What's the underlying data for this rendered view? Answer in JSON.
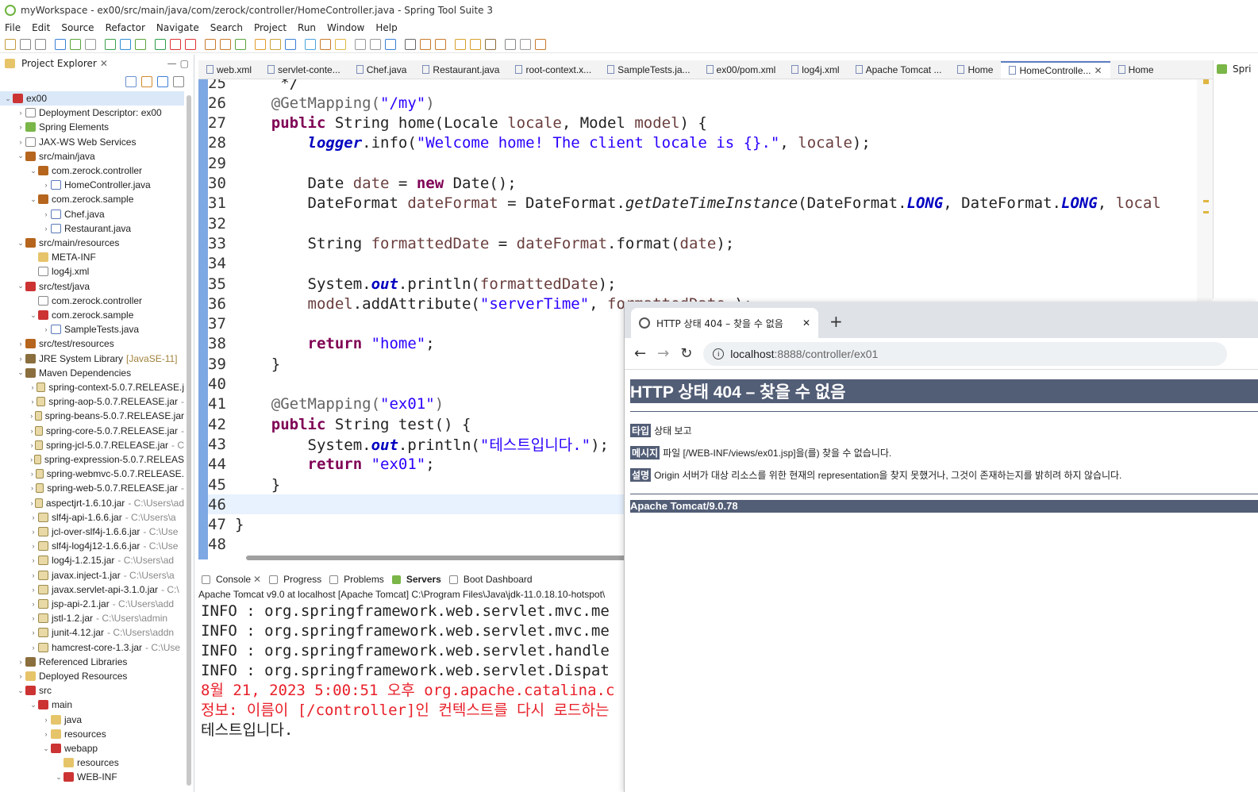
{
  "window": {
    "title": "myWorkspace - ex00/src/main/java/com/zerock/controller/HomeController.java - Spring Tool Suite 3"
  },
  "menu": [
    "File",
    "Edit",
    "Source",
    "Refactor",
    "Navigate",
    "Search",
    "Project",
    "Run",
    "Window",
    "Help"
  ],
  "explorer": {
    "title": "Project Explorer",
    "items": [
      {
        "label": "ex00",
        "indent": 0,
        "chev": "⌄",
        "icon": "proj"
      },
      {
        "label": "Deployment Descriptor: ex00",
        "indent": 1,
        "chev": "›",
        "icon": "xml"
      },
      {
        "label": "Spring Elements",
        "indent": 1,
        "chev": "›",
        "icon": "green"
      },
      {
        "label": "JAX-WS Web Services",
        "indent": 1,
        "chev": "›",
        "icon": "xml"
      },
      {
        "label": "src/main/java",
        "indent": 1,
        "chev": "⌄",
        "icon": "pkg"
      },
      {
        "label": "com.zerock.controller",
        "indent": 2,
        "chev": "⌄",
        "icon": "pkg"
      },
      {
        "label": "HomeController.java",
        "indent": 3,
        "chev": "›",
        "icon": "java"
      },
      {
        "label": "com.zerock.sample",
        "indent": 2,
        "chev": "⌄",
        "icon": "pkg"
      },
      {
        "label": "Chef.java",
        "indent": 3,
        "chev": "›",
        "icon": "java"
      },
      {
        "label": "Restaurant.java",
        "indent": 3,
        "chev": "›",
        "icon": "java"
      },
      {
        "label": "src/main/resources",
        "indent": 1,
        "chev": "⌄",
        "icon": "pkg"
      },
      {
        "label": "META-INF",
        "indent": 2,
        "chev": "",
        "icon": "folder"
      },
      {
        "label": "log4j.xml",
        "indent": 2,
        "chev": "",
        "icon": "xml"
      },
      {
        "label": "src/test/java",
        "indent": 1,
        "chev": "⌄",
        "icon": "proj"
      },
      {
        "label": "com.zerock.controller",
        "indent": 2,
        "chev": "",
        "icon": "xml"
      },
      {
        "label": "com.zerock.sample",
        "indent": 2,
        "chev": "⌄",
        "icon": "proj"
      },
      {
        "label": "SampleTests.java",
        "indent": 3,
        "chev": "›",
        "icon": "java"
      },
      {
        "label": "src/test/resources",
        "indent": 1,
        "chev": "›",
        "icon": "pkg"
      },
      {
        "label": "JRE System Library",
        "extra": "[JavaSE-11]",
        "extraClass": "jre",
        "indent": 1,
        "chev": "›",
        "icon": "lib"
      },
      {
        "label": "Maven Dependencies",
        "indent": 1,
        "chev": "⌄",
        "icon": "lib"
      },
      {
        "label": "spring-context-5.0.7.RELEASE.j",
        "indent": 2,
        "chev": "›",
        "icon": "jar"
      },
      {
        "label": "spring-aop-5.0.7.RELEASE.jar",
        "extra": "-",
        "extraClass": "dim",
        "indent": 2,
        "chev": "›",
        "icon": "jar"
      },
      {
        "label": "spring-beans-5.0.7.RELEASE.jar",
        "indent": 2,
        "chev": "›",
        "icon": "jar"
      },
      {
        "label": "spring-core-5.0.7.RELEASE.jar",
        "extra": "-",
        "extraClass": "dim",
        "indent": 2,
        "chev": "›",
        "icon": "jar"
      },
      {
        "label": "spring-jcl-5.0.7.RELEASE.jar",
        "extra": "- C",
        "extraClass": "dim",
        "indent": 2,
        "chev": "›",
        "icon": "jar"
      },
      {
        "label": "spring-expression-5.0.7.RELEAS",
        "indent": 2,
        "chev": "›",
        "icon": "jar"
      },
      {
        "label": "spring-webmvc-5.0.7.RELEASE.",
        "indent": 2,
        "chev": "›",
        "icon": "jar"
      },
      {
        "label": "spring-web-5.0.7.RELEASE.jar",
        "extra": "-",
        "extraClass": "dim",
        "indent": 2,
        "chev": "›",
        "icon": "jar"
      },
      {
        "label": "aspectjrt-1.6.10.jar",
        "extra": "- C:\\Users\\ad",
        "extraClass": "dim",
        "indent": 2,
        "chev": "›",
        "icon": "jar"
      },
      {
        "label": "slf4j-api-1.6.6.jar",
        "extra": "- C:\\Users\\a",
        "extraClass": "dim",
        "indent": 2,
        "chev": "›",
        "icon": "jar"
      },
      {
        "label": "jcl-over-slf4j-1.6.6.jar",
        "extra": "- C:\\Use",
        "extraClass": "dim",
        "indent": 2,
        "chev": "›",
        "icon": "jar"
      },
      {
        "label": "slf4j-log4j12-1.6.6.jar",
        "extra": "- C:\\Use",
        "extraClass": "dim",
        "indent": 2,
        "chev": "›",
        "icon": "jar"
      },
      {
        "label": "log4j-1.2.15.jar",
        "extra": "- C:\\Users\\ad",
        "extraClass": "dim",
        "indent": 2,
        "chev": "›",
        "icon": "jar"
      },
      {
        "label": "javax.inject-1.jar",
        "extra": "- C:\\Users\\a",
        "extraClass": "dim",
        "indent": 2,
        "chev": "›",
        "icon": "jar"
      },
      {
        "label": "javax.servlet-api-3.1.0.jar",
        "extra": "- C:\\",
        "extraClass": "dim",
        "indent": 2,
        "chev": "›",
        "icon": "jar"
      },
      {
        "label": "jsp-api-2.1.jar",
        "extra": "- C:\\Users\\add",
        "extraClass": "dim",
        "indent": 2,
        "chev": "›",
        "icon": "jar"
      },
      {
        "label": "jstl-1.2.jar",
        "extra": "- C:\\Users\\admin",
        "extraClass": "dim",
        "indent": 2,
        "chev": "›",
        "icon": "jar"
      },
      {
        "label": "junit-4.12.jar",
        "extra": "- C:\\Users\\addn",
        "extraClass": "dim",
        "indent": 2,
        "chev": "›",
        "icon": "jar"
      },
      {
        "label": "hamcrest-core-1.3.jar",
        "extra": "- C:\\Use",
        "extraClass": "dim",
        "indent": 2,
        "chev": "›",
        "icon": "jar"
      },
      {
        "label": "Referenced Libraries",
        "indent": 1,
        "chev": "›",
        "icon": "lib"
      },
      {
        "label": "Deployed Resources",
        "indent": 1,
        "chev": "›",
        "icon": "folder"
      },
      {
        "label": "src",
        "indent": 1,
        "chev": "⌄",
        "icon": "proj"
      },
      {
        "label": "main",
        "indent": 2,
        "chev": "⌄",
        "icon": "proj"
      },
      {
        "label": "java",
        "indent": 3,
        "chev": "›",
        "icon": "folder"
      },
      {
        "label": "resources",
        "indent": 3,
        "chev": "›",
        "icon": "folder"
      },
      {
        "label": "webapp",
        "indent": 3,
        "chev": "⌄",
        "icon": "proj"
      },
      {
        "label": "resources",
        "indent": 4,
        "chev": "",
        "icon": "folder"
      },
      {
        "label": "WEB-INF",
        "indent": 4,
        "chev": "⌄",
        "icon": "proj"
      }
    ]
  },
  "editor_tabs": [
    "web.xml",
    "servlet-conte...",
    "Chef.java",
    "Restaurant.java",
    "root-context.x...",
    "SampleTests.ja...",
    "ex00/pom.xml",
    "log4j.xml",
    "Apache Tomcat ...",
    "Home",
    "HomeControlle...",
    "Home"
  ],
  "active_tab_index": 10,
  "right_panel_label": "Spri",
  "code_lines": [
    {
      "n": "25",
      "html": "     */"
    },
    {
      "n": "26",
      "html": "    <span class='ann'>@GetMapping(</span><span class='str'>\"/my\"</span><span class='ann'>)</span>"
    },
    {
      "n": "27",
      "html": "    <span class='kw'>public</span> String home(Locale <span class='var'>locale</span>, Model <span class='var'>model</span>) {"
    },
    {
      "n": "28",
      "html": "        <span class='field'>logger</span>.info(<span class='str'>\"Welcome home! The client locale is {}.\"</span>, <span class='var'>locale</span>);"
    },
    {
      "n": "29",
      "html": ""
    },
    {
      "n": "30",
      "html": "        Date <span class='var'>date</span> = <span class='kw'>new</span> Date();"
    },
    {
      "n": "31",
      "html": "        DateFormat <span class='var'>dateFormat</span> = DateFormat.<span class='itx'>getDateTimeInstance</span>(DateFormat.<span class='cst'>LONG</span>, DateFormat.<span class='cst'>LONG</span>, <span class='var'>local</span>"
    },
    {
      "n": "32",
      "html": ""
    },
    {
      "n": "33",
      "html": "        String <span class='var'>formattedDate</span> = <span class='var'>dateFormat</span>.format(<span class='var'>date</span>);"
    },
    {
      "n": "34",
      "html": ""
    },
    {
      "n": "35",
      "html": "        System.<span class='field'>out</span>.println(<span class='var'>formattedDate</span>);"
    },
    {
      "n": "36",
      "html": "        <span class='var'>model</span>.addAttribute(<span class='str'>\"serverTime\"</span>, <span class='var'>formattedDate</span> );"
    },
    {
      "n": "37",
      "html": ""
    },
    {
      "n": "38",
      "html": "        <span class='kw'>return</span> <span class='str'>\"home\"</span>;"
    },
    {
      "n": "39",
      "html": "    }"
    },
    {
      "n": "40",
      "html": ""
    },
    {
      "n": "41",
      "html": "    <span class='ann'>@GetMapping(</span><span class='str'>\"ex01\"</span><span class='ann'>)</span>"
    },
    {
      "n": "42",
      "html": "    <span class='kw'>public</span> String test() {"
    },
    {
      "n": "43",
      "html": "        System.<span class='field'>out</span>.println(<span class='str'>\"테스트입니다.\"</span>);"
    },
    {
      "n": "44",
      "html": "        <span class='kw'>return</span> <span class='str'>\"ex01\"</span>;"
    },
    {
      "n": "45",
      "html": "    }"
    },
    {
      "n": "46",
      "html": ""
    },
    {
      "n": "47",
      "html": "}"
    },
    {
      "n": "48",
      "html": ""
    }
  ],
  "console": {
    "tabs": [
      "Console",
      "Progress",
      "Problems",
      "Servers",
      "Boot Dashboard"
    ],
    "header": "Apache Tomcat v9.0  at localhost [Apache Tomcat] C:\\Program Files\\Java\\jdk-11.0.18.10-hotspot\\",
    "lines": [
      {
        "text": "INFO : org.springframework.web.servlet.mvc.me",
        "red": false
      },
      {
        "text": "INFO : org.springframework.web.servlet.mvc.me",
        "red": false
      },
      {
        "text": "INFO : org.springframework.web.servlet.handle",
        "red": false
      },
      {
        "text": "INFO : org.springframework.web.servlet.Dispat",
        "red": false
      },
      {
        "text": "8월 21, 2023 5:00:51 오후 org.apache.catalina.c",
        "red": true
      },
      {
        "text": "정보: 이름이 [/controller]인 컨텍스트를 다시 로드하는",
        "red": true
      },
      {
        "text": "테스트입니다.",
        "red": false
      }
    ]
  },
  "browser": {
    "tab_title": "HTTP 상태 404 – 찾을 수 없음",
    "url_host": "localhost",
    "url_rest": ":8888/controller/ex01",
    "heading": "HTTP 상태 404 – 찾을 수 없음",
    "type_label": "타입",
    "type_value": "상태 보고",
    "message_label": "메시지",
    "message_value": "파일 [/WEB-INF/views/ex01.jsp]을(를) 찾을 수 없습니다.",
    "desc_label": "설명",
    "desc_value": "Origin 서버가 대상 리소스를 위한 현재의 representation을 찾지 못했거나, 그것이 존재하는지를 밝히려 하지 않습니다.",
    "footer": "Apache Tomcat/9.0.78"
  }
}
